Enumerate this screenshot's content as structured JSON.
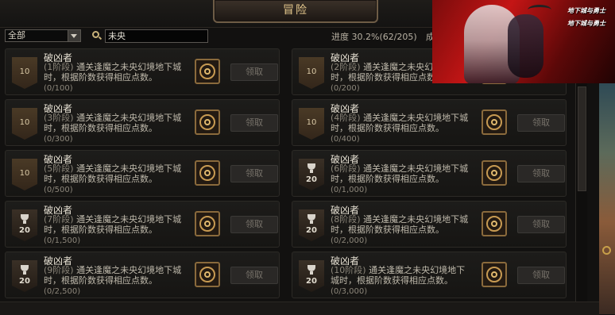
{
  "header": {
    "title": "冒险"
  },
  "filters": {
    "category_selected": "全部",
    "search_value": "未央",
    "progress_text": "进度 30.2%(62/205)",
    "progress_extra": "成"
  },
  "ad": {
    "brand_lines": [
      "地下城与勇士",
      "地下城与勇士"
    ]
  },
  "cards": [
    {
      "title": "破凶者",
      "stage": "(1阶段)",
      "desc": "通关逢魔之未央幻境地下城时，根据阶数获得相应点数。",
      "progress": "(0/100)",
      "badge": "10",
      "trophy": false,
      "claim": "领取"
    },
    {
      "title": "破凶者",
      "stage": "(2阶段)",
      "desc": "通关逢魔之未央幻境地下城时，根据阶数获得相应点数。",
      "progress": "(0/200)",
      "badge": "10",
      "trophy": false,
      "claim": "领取"
    },
    {
      "title": "破凶者",
      "stage": "(3阶段)",
      "desc": "通关逢魔之未央幻境地下城时，根据阶数获得相应点数。",
      "progress": "(0/300)",
      "badge": "10",
      "trophy": false,
      "claim": "领取"
    },
    {
      "title": "破凶者",
      "stage": "(4阶段)",
      "desc": "通关逢魔之未央幻境地下城时，根据阶数获得相应点数。",
      "progress": "(0/400)",
      "badge": "10",
      "trophy": false,
      "claim": "领取"
    },
    {
      "title": "破凶者",
      "stage": "(5阶段)",
      "desc": "通关逢魔之未央幻境地下城时，根据阶数获得相应点数。",
      "progress": "(0/500)",
      "badge": "10",
      "trophy": false,
      "claim": "领取"
    },
    {
      "title": "破凶者",
      "stage": "(6阶段)",
      "desc": "通关逢魔之未央幻境地下城时，根据阶数获得相应点数。",
      "progress": "(0/1,000)",
      "badge": "20",
      "trophy": true,
      "claim": "领取"
    },
    {
      "title": "破凶者",
      "stage": "(7阶段)",
      "desc": "通关逢魔之未央幻境地下城时，根据阶数获得相应点数。",
      "progress": "(0/1,500)",
      "badge": "20",
      "trophy": true,
      "claim": "领取"
    },
    {
      "title": "破凶者",
      "stage": "(8阶段)",
      "desc": "通关逢魔之未央幻境地下城时，根据阶数获得相应点数。",
      "progress": "(0/2,000)",
      "badge": "20",
      "trophy": true,
      "claim": "领取"
    },
    {
      "title": "破凶者",
      "stage": "(9阶段)",
      "desc": "通关逢魔之未央幻境地下城时，根据阶数获得相应点数。",
      "progress": "(0/2,500)",
      "badge": "20",
      "trophy": true,
      "claim": "领取"
    },
    {
      "title": "破凶者",
      "stage": "(10阶段)",
      "desc": "通关逢魔之未央幻境地下城时，根据阶数获得相应点数。",
      "progress": "(0/3,000)",
      "badge": "20",
      "trophy": true,
      "claim": "领取"
    }
  ]
}
